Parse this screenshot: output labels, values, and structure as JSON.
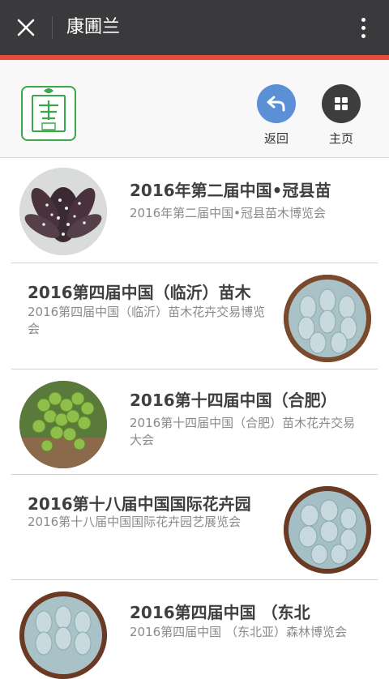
{
  "window": {
    "title": "康圃兰",
    "close_icon": "close-icon",
    "more_icon": "more-vertical-icon"
  },
  "colors": {
    "topbar": "#3a3a3c",
    "accent": "#e84c3d",
    "back_button": "#5b8fd6",
    "home_button": "#3d3d3d",
    "logo_green": "#3aa84a"
  },
  "header": {
    "logo_icon": "kangpulan-logo",
    "back_label": "返回",
    "home_label": "主页",
    "back_icon": "back-arrow-icon",
    "home_icon": "grid-icon"
  },
  "articles": [
    {
      "title": "2016年第二届中国•冠县苗",
      "desc": "2016年第二届中国•冠县苗木博览会",
      "image": "succulent-spotted-leaves"
    },
    {
      "title": "2016第四届中国（临沂）苗木",
      "desc": "2016第四届中国（临沂）苗木花卉交易博览会",
      "image": "succulent-pale-blue-rosette"
    },
    {
      "title": "2016第十四届中国（合肥）",
      "desc": "2016第十四届中国（合肥）苗木花卉交易大会",
      "image": "succulent-green-beads"
    },
    {
      "title": "2016第十八届中国国际花卉园",
      "desc": "2016第十八届中国国际花卉园艺展览会",
      "image": "succulent-pale-blue-rosette"
    },
    {
      "title": "2016第四届中国 （东北",
      "desc": "2016第四届中国 （东北亚）森林博览会",
      "image": "succulent-pale-blue-rosette"
    }
  ]
}
